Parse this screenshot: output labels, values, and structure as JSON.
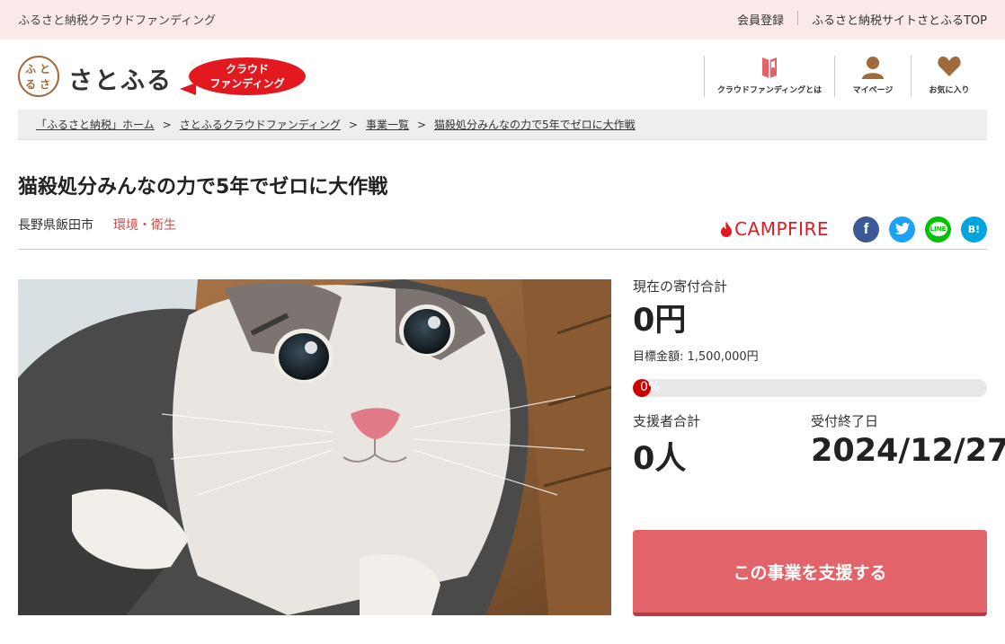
{
  "topbar": {
    "site_name": "ふるさと納税クラウドファンディング",
    "links": [
      "会員登録",
      "ふるさと納税サイトさとふるTOP"
    ]
  },
  "header": {
    "logo_text": "さとふる",
    "logo_mark_chars": [
      "ふ",
      "る",
      "さ",
      "と"
    ],
    "badge_lines": [
      "クラウド",
      "ファンディング"
    ],
    "nav": [
      {
        "label": "クラウドファンディングとは",
        "icon": "book-icon"
      },
      {
        "label": "マイページ",
        "icon": "user-icon"
      },
      {
        "label": "お気に入り",
        "icon": "heart-icon"
      }
    ]
  },
  "breadcrumb": {
    "items": [
      "「ふるさと納税」ホーム",
      "さとふるクラウドファンディング",
      "事業一覧",
      "猫殺処分みんなの力で5年でゼロに大作戦"
    ],
    "separator": ">"
  },
  "project": {
    "title": "猫殺処分みんなの力で5年でゼロに大作戦",
    "city": "長野県飯田市",
    "category": "環境・衛生"
  },
  "share": {
    "campfire": "CAMPFIRE",
    "buttons": [
      {
        "name": "facebook",
        "glyph": "f",
        "color": "#3b5998"
      },
      {
        "name": "twitter",
        "glyph": "t",
        "color": "#1da1f2"
      },
      {
        "name": "line",
        "glyph": "LINE",
        "color": "#00c300"
      },
      {
        "name": "hatena",
        "glyph": "B!",
        "color": "#00a4de"
      }
    ]
  },
  "stats": {
    "total_label": "現在の寄付合計",
    "total_value": "0円",
    "goal_text": "目標金額: 1,500,000円",
    "progress_text": "0%",
    "progress_value": 0,
    "supporters_label": "支援者合計",
    "supporters_value": "0人",
    "deadline_label": "受付終了日",
    "deadline_value": "2024/12/27"
  },
  "cta": {
    "label": "この事業を支援する"
  },
  "colors": {
    "accent": "#e2646a",
    "topbar": "#fbe9e9",
    "campfire": "#e2191f"
  }
}
